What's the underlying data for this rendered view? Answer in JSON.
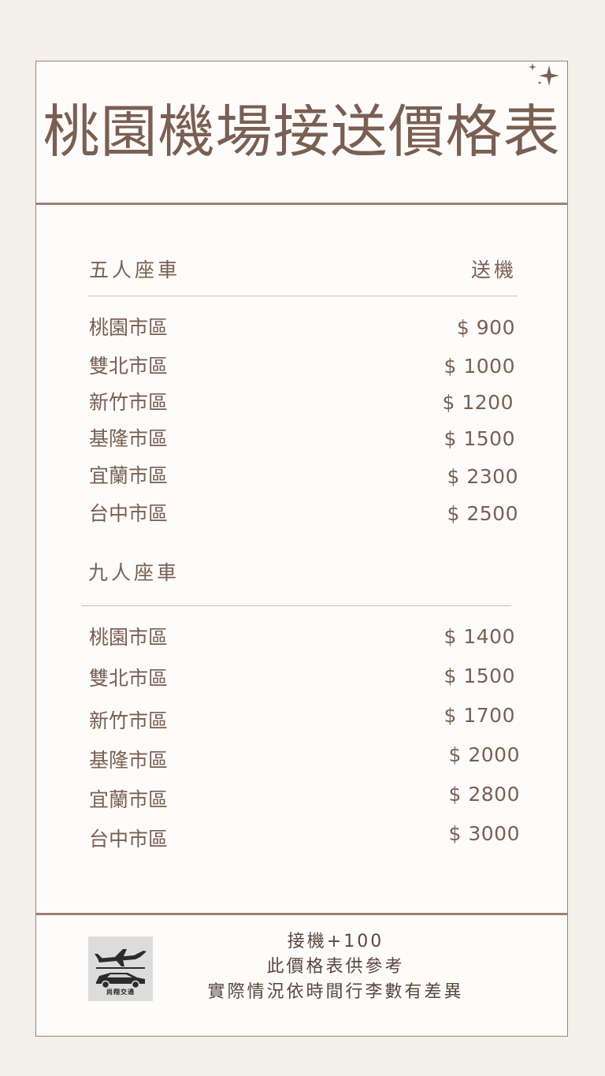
{
  "title": "桃園機場接送價格表",
  "five_seat": {
    "label": "五人座車",
    "column_label": "送機",
    "rows": [
      {
        "name": "桃園市區",
        "price": "$ 900"
      },
      {
        "name": "雙北市區",
        "price": "$ 1000"
      },
      {
        "name": "新竹市區",
        "price": "$ 1200"
      },
      {
        "name": "基隆市區",
        "price": "$ 1500"
      },
      {
        "name": "宜蘭市區",
        "price": "$ 2300"
      },
      {
        "name": "台中市區",
        "price": "$ 2500"
      }
    ]
  },
  "nine_seat": {
    "label": "九人座車",
    "rows": [
      {
        "name": "桃園市區",
        "price": "$ 1400"
      },
      {
        "name": "雙北市區",
        "price": "$ 1500"
      },
      {
        "name": "新竹市區",
        "price": "$ 1700"
      },
      {
        "name": "基隆市區",
        "price": "$ 2000"
      },
      {
        "name": "宜蘭市區",
        "price": "$ 2800"
      },
      {
        "name": "台中市區",
        "price": "$ 3000"
      }
    ]
  },
  "footer": {
    "notes": [
      "接機+100",
      "此價格表供參考",
      "實際情況依時間行李數有差異"
    ],
    "logo_text": "尚翔交通"
  },
  "icons": {
    "sparkle": "sparkle-icon",
    "logo": "airplane-car-logo"
  },
  "colors": {
    "text": "#7a5f52",
    "border": "#9b8275",
    "background": "#f3efe9",
    "card": "#fdfcfb"
  }
}
